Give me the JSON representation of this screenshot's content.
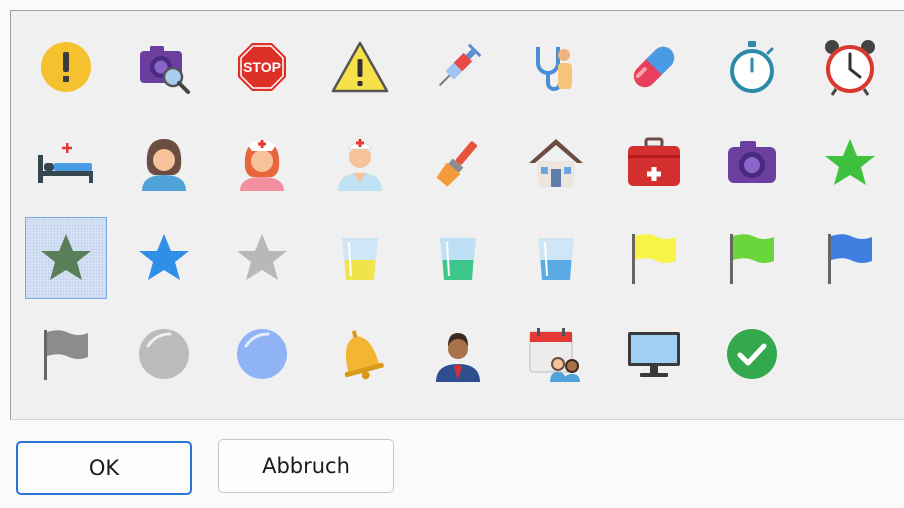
{
  "icons": [
    {
      "name": "exclamation-icon",
      "selected": false
    },
    {
      "name": "camera-search-icon",
      "selected": false
    },
    {
      "name": "stop-sign-icon",
      "selected": false
    },
    {
      "name": "warning-icon",
      "selected": false
    },
    {
      "name": "syringe-icon",
      "selected": false
    },
    {
      "name": "doctor-stethoscope-icon",
      "selected": false
    },
    {
      "name": "pill-icon",
      "selected": false
    },
    {
      "name": "stopwatch-icon",
      "selected": false
    },
    {
      "name": "alarm-clock-icon",
      "selected": false
    },
    {
      "name": "hospital-bed-icon",
      "selected": false
    },
    {
      "name": "woman-avatar-icon",
      "selected": false
    },
    {
      "name": "nurse-icon",
      "selected": false
    },
    {
      "name": "male-nurse-icon",
      "selected": false
    },
    {
      "name": "paintbrush-icon",
      "selected": false
    },
    {
      "name": "house-icon",
      "selected": false
    },
    {
      "name": "first-aid-kit-icon",
      "selected": false
    },
    {
      "name": "camera-icon",
      "selected": false
    },
    {
      "name": "green-star-icon",
      "selected": false
    },
    {
      "name": "dark-green-star-icon",
      "selected": true
    },
    {
      "name": "blue-star-icon",
      "selected": false
    },
    {
      "name": "gray-star-icon",
      "selected": false
    },
    {
      "name": "glass-yellow-liquid-icon",
      "selected": false
    },
    {
      "name": "glass-green-liquid-icon",
      "selected": false
    },
    {
      "name": "glass-blue-liquid-icon",
      "selected": false
    },
    {
      "name": "yellow-flag-icon",
      "selected": false
    },
    {
      "name": "green-flag-icon",
      "selected": false
    },
    {
      "name": "blue-flag-icon",
      "selected": false
    },
    {
      "name": "gray-flag-icon",
      "selected": false
    },
    {
      "name": "gray-sphere-icon",
      "selected": false
    },
    {
      "name": "blue-sphere-icon",
      "selected": false
    },
    {
      "name": "bell-icon",
      "selected": false
    },
    {
      "name": "businessman-icon",
      "selected": false
    },
    {
      "name": "calendar-people-icon",
      "selected": false
    },
    {
      "name": "monitor-icon",
      "selected": false
    },
    {
      "name": "green-checkmark-icon",
      "selected": false
    }
  ],
  "stop_text": "STOP",
  "buttons": {
    "ok_label": "OK",
    "cancel_label": "Abbruch"
  }
}
